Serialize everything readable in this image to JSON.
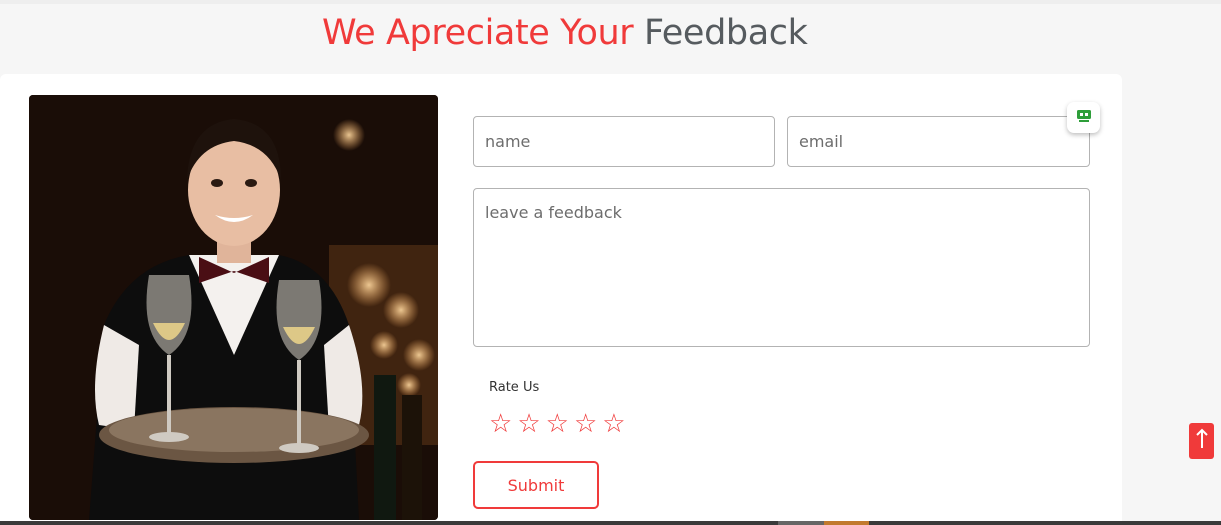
{
  "heading": {
    "accent": "We Apreciate Your",
    "rest": "Feedback"
  },
  "form": {
    "name_placeholder": "name",
    "email_placeholder": "email",
    "feedback_placeholder": "leave a feedback",
    "rate_label": "Rate Us",
    "rating": {
      "value": 0,
      "max": 5
    },
    "star_glyph": "☆",
    "submit_label": "Submit"
  },
  "photo": {
    "alt": "waitress-with-wine-tray-image"
  },
  "colors": {
    "accent": "#f03a3a",
    "heading_dark": "#565b5f",
    "background": "#f6f6f6"
  },
  "icons": {
    "widget": "chat-bot-icon",
    "scroll_top": "arrow-up-icon"
  }
}
